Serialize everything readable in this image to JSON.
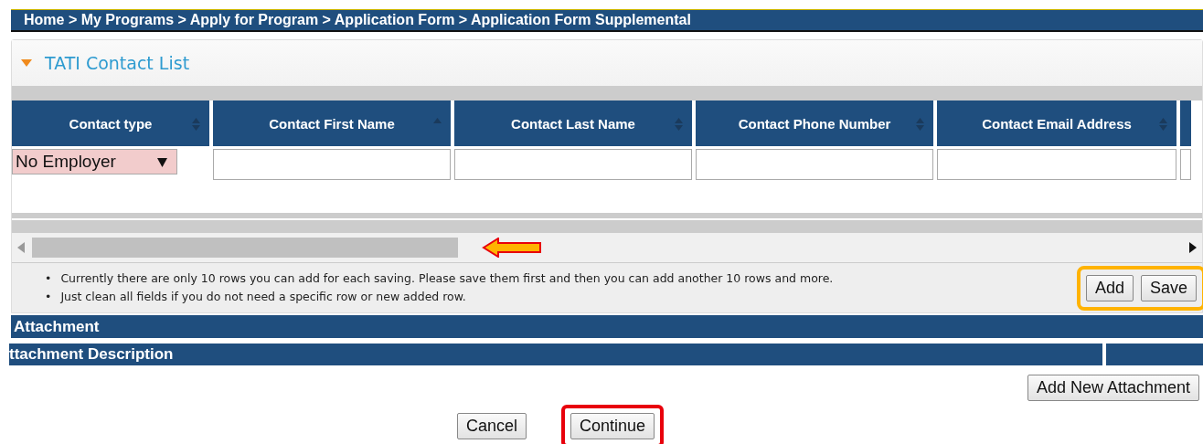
{
  "breadcrumb": "Home > My Programs > Apply for Program > Application Form > Application Form Supplemental",
  "panel": {
    "title": "TATI Contact List",
    "expanded": true
  },
  "table": {
    "columns": [
      {
        "label": "Contact type",
        "sorted": false
      },
      {
        "label": "Contact First Name",
        "sorted": true
      },
      {
        "label": "Contact Last Name",
        "sorted": false
      },
      {
        "label": "Contact Phone Number",
        "sorted": false
      },
      {
        "label": "Contact Email Address",
        "sorted": false
      }
    ],
    "rows": [
      {
        "contact_type": "No Employer"
      }
    ]
  },
  "notes": [
    {
      "marker": "•",
      "text": "Currently there are only 10 rows you can add for each saving. Please save them first and then you can add another 10 rows and more."
    },
    {
      "marker": "•",
      "text": "Just clean all fields if you do not need a specific row or new added row."
    }
  ],
  "buttons": [
    "Add",
    "Save"
  ],
  "attachment": {
    "title": "Attachment",
    "columns": [
      "ttachment Description"
    ],
    "button": "Add New Attachment"
  },
  "footer_buttons": [
    {
      "label": "Cancel",
      "highlighted": false
    },
    {
      "label": "Continue",
      "highlighted": true
    }
  ]
}
